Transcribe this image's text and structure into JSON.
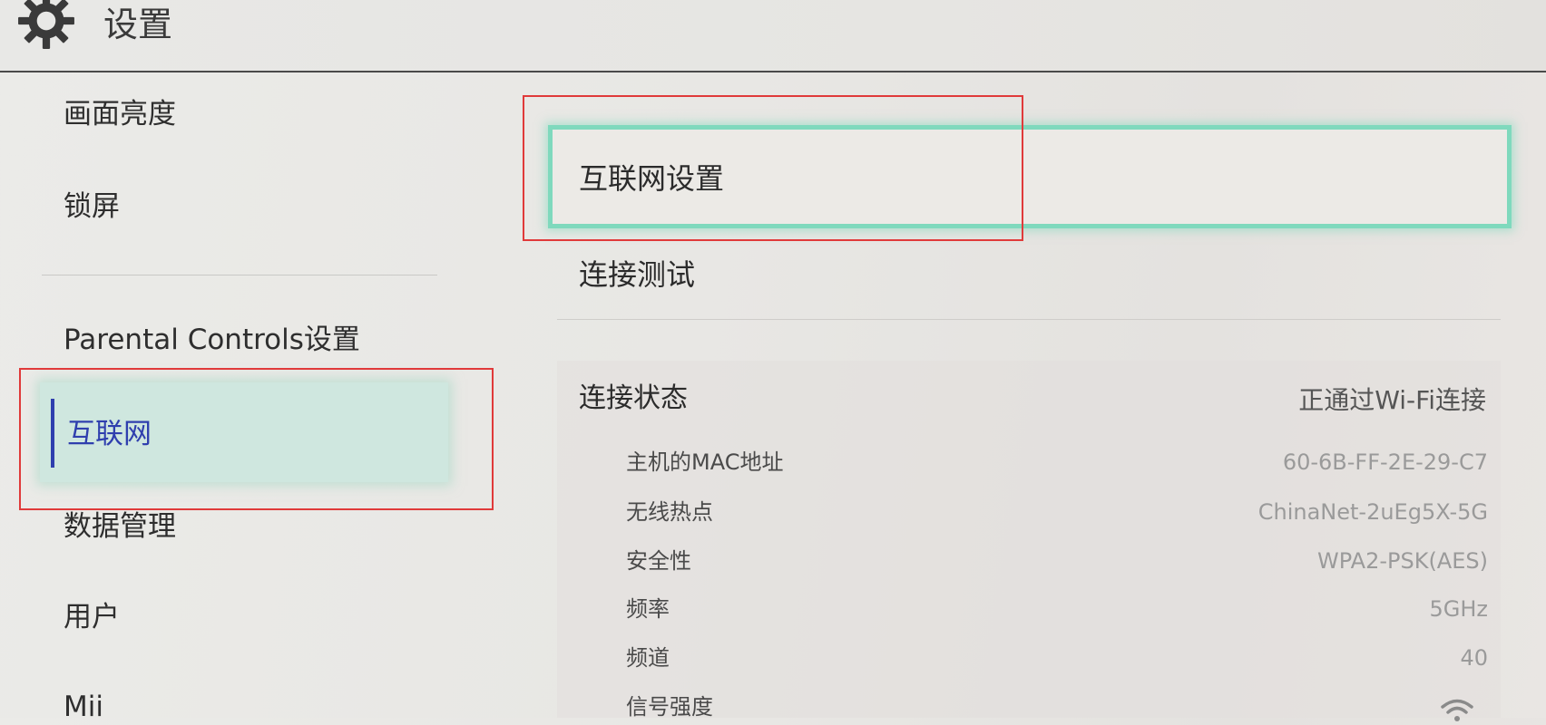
{
  "header": {
    "title": "设置",
    "icon": "gear-icon"
  },
  "sidebar": {
    "items": [
      {
        "label": "画面亮度"
      },
      {
        "label": "锁屏"
      },
      {
        "label": "Parental Controls设置"
      },
      {
        "label": "互联网",
        "selected": true
      },
      {
        "label": "数据管理"
      },
      {
        "label": "用户"
      },
      {
        "label": "Mii"
      }
    ]
  },
  "main": {
    "internet_settings_label": "互联网设置",
    "connection_test_label": "连接测试",
    "status": {
      "label": "连接状态",
      "value": "正通过Wi-Fi连接"
    },
    "details": [
      {
        "label": "主机的MAC地址",
        "value": "60-6B-FF-2E-29-C7"
      },
      {
        "label": "无线热点",
        "value": "ChinaNet-2uEg5X-5G"
      },
      {
        "label": "安全性",
        "value": "WPA2-PSK(AES)"
      },
      {
        "label": "频率",
        "value": "5GHz"
      },
      {
        "label": "频道",
        "value": "40"
      },
      {
        "label": "信号强度",
        "value_icon": "wifi-signal-icon"
      }
    ]
  },
  "colors": {
    "selection_accent": "#2f3fae",
    "focus_border": "#7fd9bd",
    "annotation_red": "#e03a3a"
  }
}
